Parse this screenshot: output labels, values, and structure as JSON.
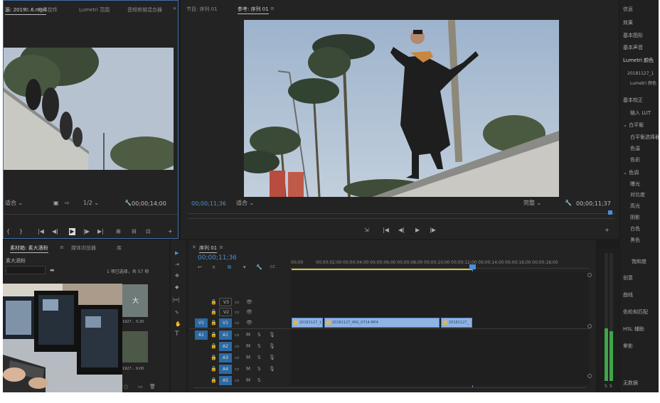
{
  "source_panel": {
    "tabs": [
      "源: 2019...6.mp4",
      "效果控件",
      "Lumetri 范围",
      "音频剪辑混合器"
    ],
    "menu_glyph": "≡",
    "overflow_glyph": "»",
    "fit_label": "适合",
    "quality_label": "1/2",
    "timecode": "00;00;14;00",
    "controls": [
      "{",
      "}",
      "|◀",
      "◀|",
      "▶",
      "|▶",
      "▶|",
      "⊞",
      "⊟",
      "⊡",
      "▣",
      "+"
    ]
  },
  "program_panel": {
    "tabs": [
      "节目: 序列 01",
      "参考: 序列 01"
    ],
    "menu_glyph": "≡",
    "timecode_left": "00;00;11;36",
    "fit_label": "适合",
    "quality_label": "完整",
    "timecode_right": "00;00;11;37",
    "controls": [
      "⇲",
      "|◀",
      "◀|",
      "▶",
      "|▶",
      "+"
    ]
  },
  "right_panel": {
    "headers": [
      "信息",
      "效果",
      "基本图形",
      "基本声音",
      "Lumetri 颜色"
    ],
    "clip_ref": "20181127_1",
    "lumetri_tab": "Lumetri 颜色",
    "sections": [
      "基本校正",
      "输入 LUT",
      "白平衡",
      "白平衡选择器",
      "色温",
      "色彩",
      "色调",
      "曝光",
      "对比度",
      "高光",
      "阴影",
      "白色",
      "黑色",
      "饱和度"
    ],
    "panels_below": [
      "创意",
      "曲线",
      "色轮和匹配",
      "HSL 辅助",
      "晕影"
    ],
    "reset_label": "无数据"
  },
  "project_panel": {
    "tabs": [
      "素材箱: 素大酒粉",
      "媒体浏览器",
      "库"
    ],
    "menu_glyph": "≡",
    "folder_name": "素大酒粉",
    "item_count_label": "1 项已选择，共 57 项",
    "thumb_labels": [
      "大",
      "1927... 5:20",
      "1927... 9:00"
    ]
  },
  "timeline": {
    "tab_label": "序列 01",
    "menu_glyph": "≡",
    "timecode": "00;00;11;36",
    "ruler_labels": [
      "00;00",
      "00;00;02;00",
      "00;00;04;00",
      "00;00;06;00",
      "00;00;08;00",
      "00;00;10;00",
      "00;00;12;00",
      "00;00;14;00",
      "00;00;16;00",
      "00;00;18;00"
    ],
    "video_tracks": [
      "V3",
      "V2",
      "V1"
    ],
    "audio_tracks": [
      "A1",
      "A2",
      "A3",
      "A4",
      "A5"
    ],
    "source_patch_video": "V1",
    "source_patch_audio": "A1",
    "track_toggle_glyphs": {
      "lock": "🔒",
      "sync": "▭",
      "eye": "👁",
      "mute": "M",
      "solo": "S",
      "mic": "🎙"
    },
    "clips": [
      "20181127_1",
      "20181127_IMG_0714.MP4",
      "20181127_"
    ],
    "meter_scale": [
      "S",
      "S"
    ]
  },
  "tools": [
    "▶",
    "⇥",
    "✥",
    "◆",
    "|↔|",
    "✎",
    "✋",
    "T"
  ],
  "accent_color": "#4a8fd8",
  "clip_color": "#8fb4e4"
}
